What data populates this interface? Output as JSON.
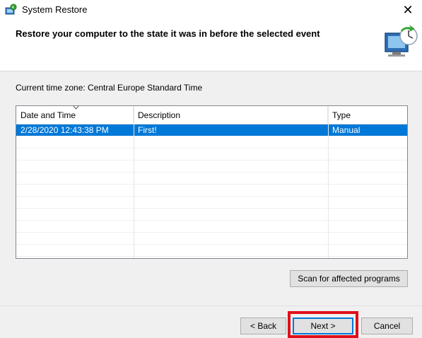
{
  "window": {
    "title": "System Restore",
    "close_glyph": "✕",
    "icons": [
      "system-restore-icon",
      "close-icon"
    ]
  },
  "header": {
    "heading": "Restore your computer to the state it was in before the selected event",
    "icon": "system-restore-wizard-icon"
  },
  "timezone": {
    "label": "Current time zone: Central Europe Standard Time"
  },
  "restore_list": {
    "columns": [
      "Date and Time",
      "Description",
      "Type"
    ],
    "sort_icon": "sort-descending-icon",
    "rows": [
      {
        "date": "2/28/2020 12:43:38 PM",
        "description": "First!",
        "type": "Manual",
        "selected": true
      }
    ]
  },
  "buttons": {
    "scan": "Scan for affected programs",
    "back": "< Back",
    "next": "Next >",
    "cancel": "Cancel"
  },
  "colors": {
    "selection": "#0078d7",
    "highlight": "#e0101a",
    "window_bg": "#f0f0f0"
  }
}
